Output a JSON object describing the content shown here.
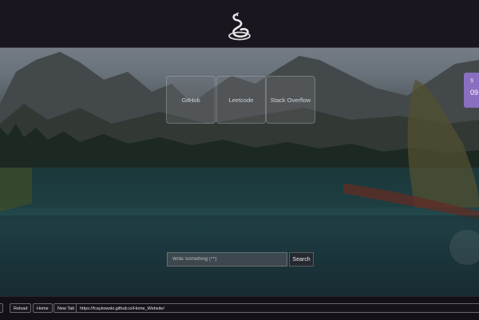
{
  "header": {
    "logo_icon": "snake-logo-icon"
  },
  "links": [
    {
      "label": "GitHub"
    },
    {
      "label": "Leetcode"
    },
    {
      "label": "Stack Overflow"
    }
  ],
  "clock": {
    "line1": "S",
    "line2": "09"
  },
  "search": {
    "placeholder": "Write Something (^^)",
    "button_label": "Search"
  },
  "toolbar": {
    "reload_label": "Reload",
    "home_label": "Home",
    "new_tab_label": "New Tab",
    "url": "https://fcaykowski.github.io/Home_Website/"
  }
}
